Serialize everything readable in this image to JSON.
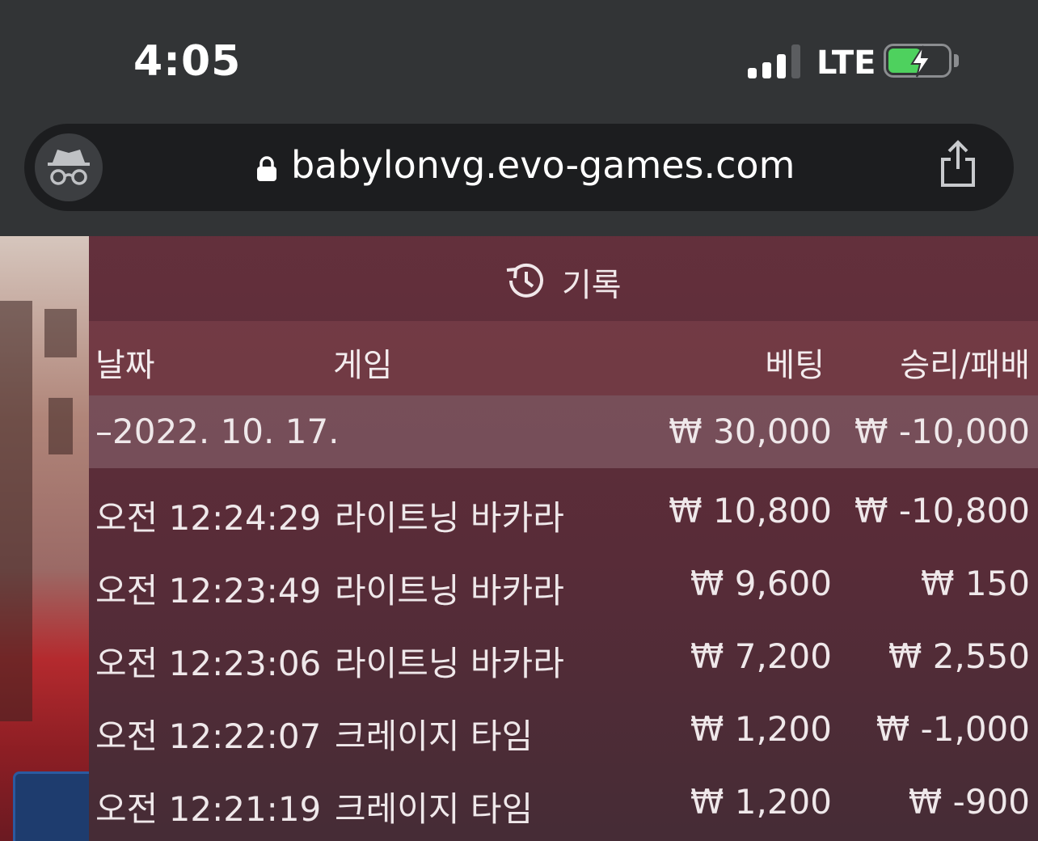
{
  "status_bar": {
    "time": "4:05",
    "network": "LTE",
    "signal_icon": "cellular-signal-icon",
    "battery_icon": "battery-charging-icon"
  },
  "browser": {
    "url": "babylonvg.evo-games.com",
    "incognito_icon": "incognito-icon",
    "lock_icon": "lock-icon",
    "share_icon": "share-icon"
  },
  "history": {
    "icon": "history-icon",
    "title": "기록",
    "columns": {
      "date": "날짜",
      "game": "게임",
      "bet": "베팅",
      "win_loss": "승리/패배"
    },
    "group": {
      "date": "–2022. 10. 17.",
      "bet": "₩ 30,000",
      "win_loss": "₩ -10,000"
    },
    "rows": [
      {
        "time": "오전 12:24:29",
        "game": "라이트닝 바카라",
        "bet": "₩ 10,800",
        "win_loss": "₩ -10,800"
      },
      {
        "time": "오전 12:23:49",
        "game": "라이트닝 바카라",
        "bet": "₩ 9,600",
        "win_loss": "₩ 150"
      },
      {
        "time": "오전 12:23:06",
        "game": "라이트닝 바카라",
        "bet": "₩ 7,200",
        "win_loss": "₩ 2,550"
      },
      {
        "time": "오전 12:22:07",
        "game": "크레이지 타임",
        "bet": "₩ 1,200",
        "win_loss": "₩ -1,000"
      },
      {
        "time": "오전 12:21:19",
        "game": "크레이지 타임",
        "bet": "₩ 1,200",
        "win_loss": "₩ -900"
      }
    ]
  },
  "colors": {
    "status_bg": "#323436",
    "address_bg": "#1c1d1f",
    "panel_bg": "#5a2a36",
    "battery_green": "#4ed15e"
  }
}
